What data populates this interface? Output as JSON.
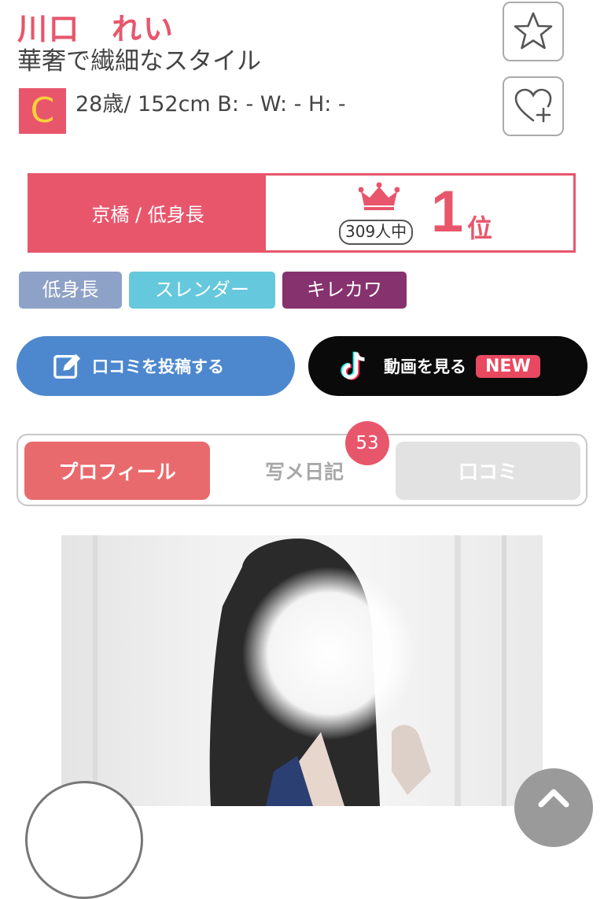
{
  "profile": {
    "name": "川口　れい",
    "catchphrase": "華奢で繊細なスタイル",
    "rank_letter": "C",
    "stats": "28歳/ 152cm B: - W: - H: -"
  },
  "actions": {
    "favorite_icon": "star-icon",
    "follow_icon": "heart-plus-icon"
  },
  "ranking": {
    "area_category": "京橋 / 低身長",
    "total_label": "309人中",
    "position": "1",
    "unit": "位"
  },
  "tags": [
    {
      "label": "低身長",
      "color": "#8ea1c6"
    },
    {
      "label": "スレンダー",
      "color": "#66c8dc"
    },
    {
      "label": "キレカワ",
      "color": "#86326e"
    }
  ],
  "buttons": {
    "post_review": "口コミを投稿する",
    "watch_video": "動画を見る",
    "new_badge": "NEW"
  },
  "tabs": {
    "profile": "プロフィール",
    "diary": "写メ日記",
    "diary_count": "53",
    "reviews": "口コミ"
  },
  "colors": {
    "accent": "#e8566c",
    "review_button": "#4d88cf",
    "video_button": "#0a0a0a"
  }
}
